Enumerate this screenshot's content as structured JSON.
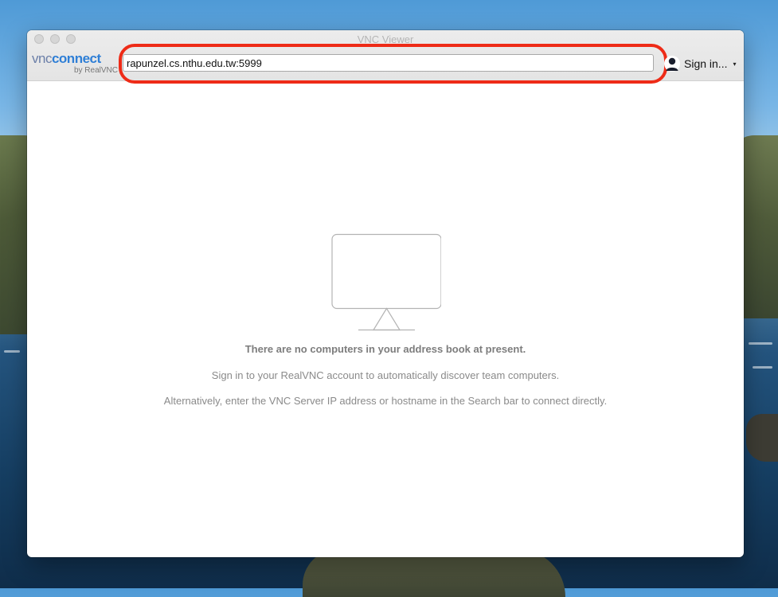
{
  "window": {
    "title": "VNC Viewer"
  },
  "logo": {
    "brand_prefix": "vnc",
    "brand_name": "connect",
    "byline": "by RealVNC"
  },
  "toolbar": {
    "address_value": "rapunzel.cs.nthu.edu.tw:5999",
    "signin_label": "Sign in...",
    "signin_caret": "▾",
    "highlight_color": "#ee2b17"
  },
  "empty_state": {
    "heading": "There are no computers in your address book at present.",
    "line1": "Sign in to your RealVNC account to automatically discover team computers.",
    "line2": "Alternatively, enter the VNC Server IP address or hostname in the Search bar to connect directly.",
    "icon": "monitor-icon"
  },
  "icons": {
    "avatar": "user-avatar-icon"
  }
}
